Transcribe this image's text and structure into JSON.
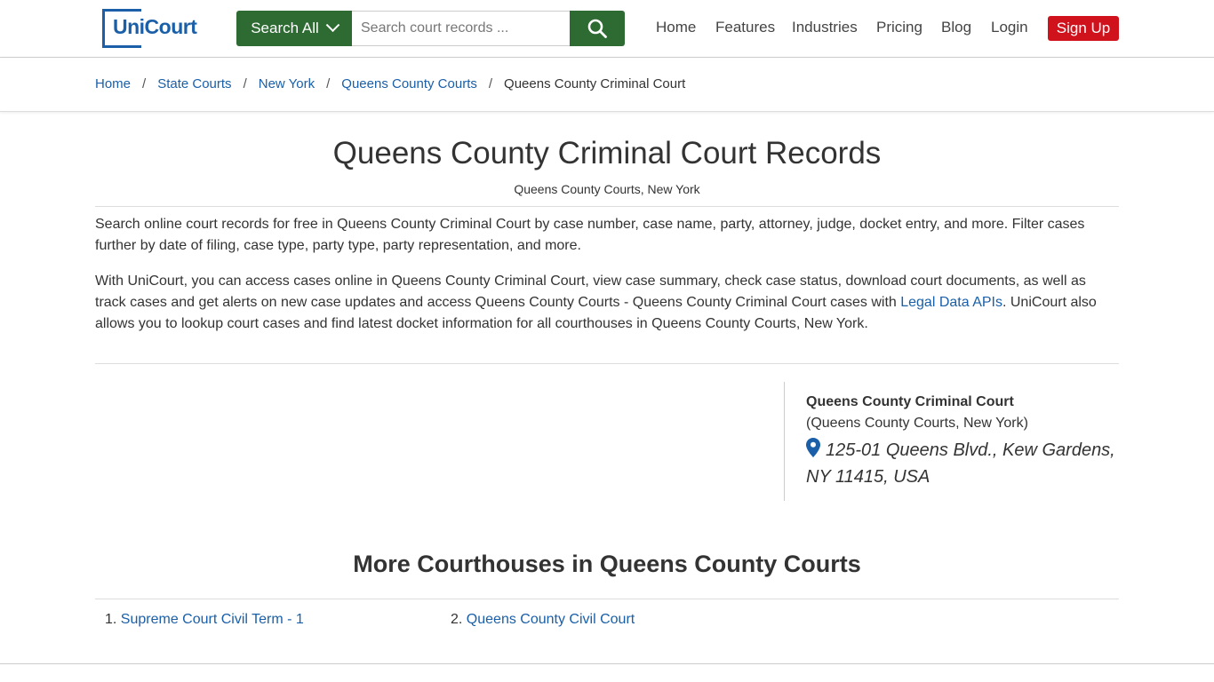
{
  "header": {
    "logo_text": "UniCourt",
    "search_all_label": "Search All",
    "search_placeholder": "Search court records ...",
    "nav": {
      "home": "Home",
      "features": "Features",
      "industries": "Industries",
      "pricing": "Pricing",
      "blog": "Blog",
      "login": "Login",
      "signup": "Sign Up"
    }
  },
  "breadcrumb": {
    "items": [
      "Home",
      "State Courts",
      "New York",
      "Queens County Courts"
    ],
    "current": "Queens County Criminal Court",
    "separator": "/"
  },
  "main": {
    "title": "Queens County Criminal Court Records",
    "subtitle": "Queens County Courts, New York",
    "para1": "Search online court records for free in Queens County Criminal Court by case number, case name, party, attorney, judge, docket entry, and more. Filter cases further by date of filing, case type, party type, party representation, and more.",
    "para2_before": "With UniCourt, you can access cases online in Queens County Criminal Court, view case summary, check case status, download court documents, as well as track cases and get alerts on new case updates and access Queens County Courts - Queens County Criminal Court cases with ",
    "para2_link": "Legal Data APIs",
    "para2_after": ". UniCourt also allows you to lookup court cases and find latest docket information for all courthouses in Queens County Courts, New York."
  },
  "court_info": {
    "name": "Queens County Criminal Court",
    "parent": "(Queens County Courts, New York)",
    "address": "125-01 Queens Blvd., Kew Gardens, NY 11415, USA"
  },
  "more": {
    "title": "More Courthouses in Queens County Courts",
    "items": [
      {
        "num": "1.",
        "label": "Supreme Court Civil Term - 1"
      },
      {
        "num": "2.",
        "label": "Queens County Civil Court"
      }
    ]
  },
  "colors": {
    "brand_blue": "#1a5fa8",
    "search_green": "#2e6b32",
    "signup_red": "#d0121c"
  }
}
